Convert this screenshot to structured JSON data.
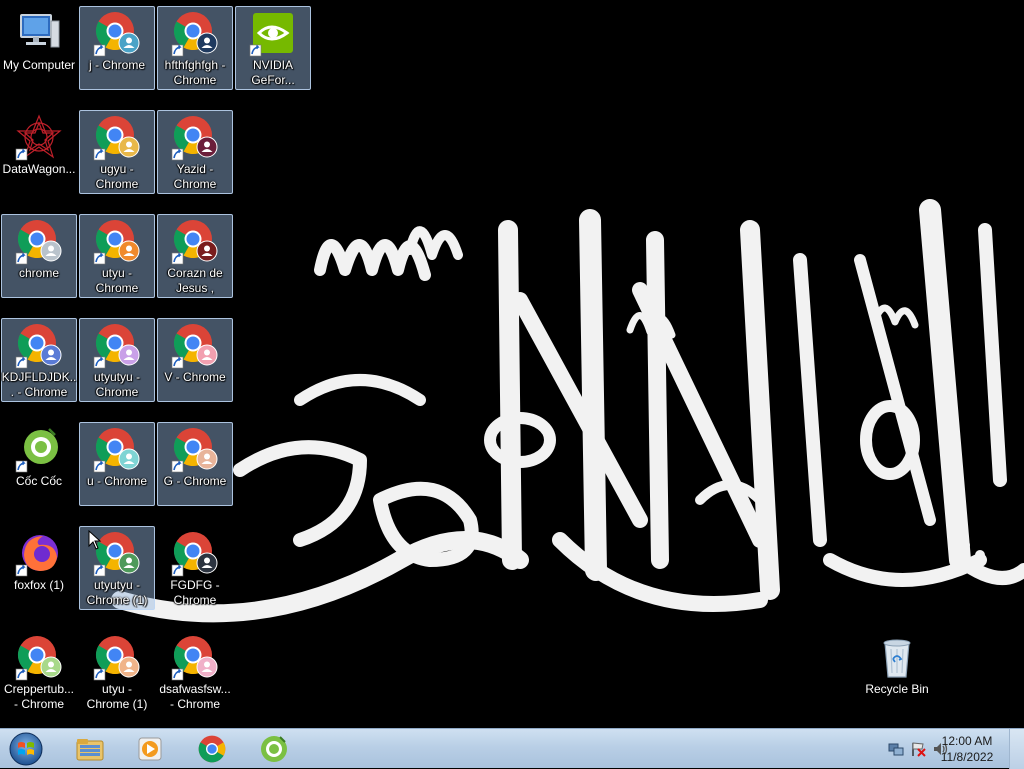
{
  "desktop": {
    "icons": [
      {
        "label": "My Computer",
        "type": "computer",
        "selected": false
      },
      {
        "label": "j - Chrome",
        "type": "chrome",
        "profile_color": "#4aa3c7",
        "selected": true
      },
      {
        "label": "hfthfghfgh - Chrome",
        "type": "chrome",
        "profile_color": "#1f3a5f",
        "selected": true
      },
      {
        "label": "NVIDIA GeFor...",
        "type": "nvidia",
        "selected": true
      },
      {
        "label": "DataWagon...",
        "type": "datawagon",
        "selected": false
      },
      {
        "label": "ugyu - Chrome",
        "type": "chrome",
        "profile_color": "#e8b84a",
        "selected": true
      },
      {
        "label": "Yazid - Chrome",
        "type": "chrome",
        "profile_color": "#6b1e3a",
        "selected": true
      },
      {
        "label": "chrome",
        "type": "chrome",
        "profile_color": "#b9c3cc",
        "selected": true
      },
      {
        "label": "utyu - Chrome",
        "type": "chrome",
        "profile_color": "#f08a2c",
        "selected": true
      },
      {
        "label": "Corazn de Jesus , JKLF...",
        "type": "chrome",
        "profile_color": "#7a1d1d",
        "selected": true
      },
      {
        "label": "KDJFLDJDK... - Chrome",
        "type": "chrome",
        "profile_color": "#5a7bd6",
        "selected": true
      },
      {
        "label": "utyutyu - Chrome",
        "type": "chrome",
        "profile_color": "#c9a0e8",
        "selected": true
      },
      {
        "label": "V - Chrome",
        "type": "chrome",
        "profile_color": "#f2a0b0",
        "selected": true
      },
      {
        "label": "Cốc Cốc",
        "type": "coccoc",
        "selected": false
      },
      {
        "label": "u - Chrome",
        "type": "chrome",
        "profile_color": "#7fd4d4",
        "selected": true
      },
      {
        "label": "G - Chrome",
        "type": "chrome",
        "profile_color": "#e8b49a",
        "selected": true
      },
      {
        "label": "foxfox (1)",
        "type": "firefox",
        "selected": false
      },
      {
        "label": "utyutyu - Chrome (1)",
        "type": "chrome",
        "profile_color": "#4e9a5a",
        "selected": true
      },
      {
        "label": "FGDFG - Chrome",
        "type": "chrome",
        "profile_color": "#2c3440",
        "selected": false
      },
      {
        "label": "Creppertub... - Chrome",
        "type": "chrome",
        "profile_color": "#a8d98a",
        "selected": false
      },
      {
        "label": "utyu - Chrome (1)",
        "type": "chrome",
        "profile_color": "#f0b48a",
        "selected": false
      },
      {
        "label": "dsafwasfsw... - Chrome",
        "type": "chrome",
        "profile_color": "#f0b0c8",
        "selected": false
      },
      {
        "label": "Recycle Bin",
        "type": "recycle",
        "selected": false
      }
    ]
  },
  "taskbar": {
    "pinned": [
      {
        "name": "windows-explorer",
        "icon": "folder-icon"
      },
      {
        "name": "media-player",
        "icon": "media-player-icon"
      },
      {
        "name": "chrome",
        "icon": "chrome-icon"
      },
      {
        "name": "coc-coc",
        "icon": "coccoc-icon"
      }
    ],
    "clock": {
      "time": "12:00 AM",
      "date": "11/8/2022"
    }
  }
}
